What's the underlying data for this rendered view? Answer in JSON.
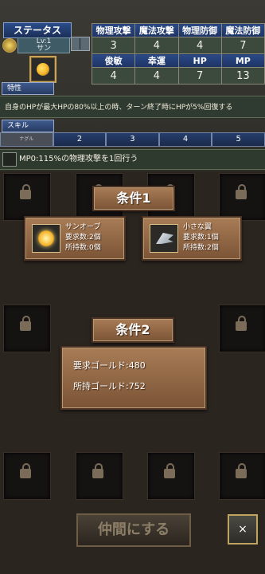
{
  "header": {
    "title": "ステータス",
    "level": "Lv:1",
    "name": "サン"
  },
  "stats": {
    "row1_headers": [
      "物理攻撃",
      "魔法攻撃",
      "物理防御",
      "魔法防御"
    ],
    "row1_values": [
      "3",
      "4",
      "4",
      "7"
    ],
    "row2_headers": [
      "俊敏",
      "幸運",
      "HP",
      "MP"
    ],
    "row2_values": [
      "4",
      "4",
      "7",
      "13"
    ]
  },
  "trait": {
    "label": "特性",
    "text": "自身のHPが最大HPの80%以上の時、ターン終了時にHPが5%回復する"
  },
  "skill": {
    "label": "スキル",
    "tabs": [
      "ナグル",
      "2",
      "3",
      "4",
      "5"
    ],
    "text": "MP0:115%の物理攻撃を1回行う"
  },
  "condition1": {
    "title": "条件1",
    "items": [
      {
        "name": "サンオーブ",
        "required": "要求数:2個",
        "owned": "所持数:0個"
      },
      {
        "name": "小さな翼",
        "required": "要求数:1個",
        "owned": "所持数:2個"
      }
    ]
  },
  "condition2": {
    "title": "条件2",
    "required_gold": "要求ゴールド:480",
    "owned_gold": "所持ゴールド:752"
  },
  "actions": {
    "join": "仲間にする",
    "close": "×"
  }
}
